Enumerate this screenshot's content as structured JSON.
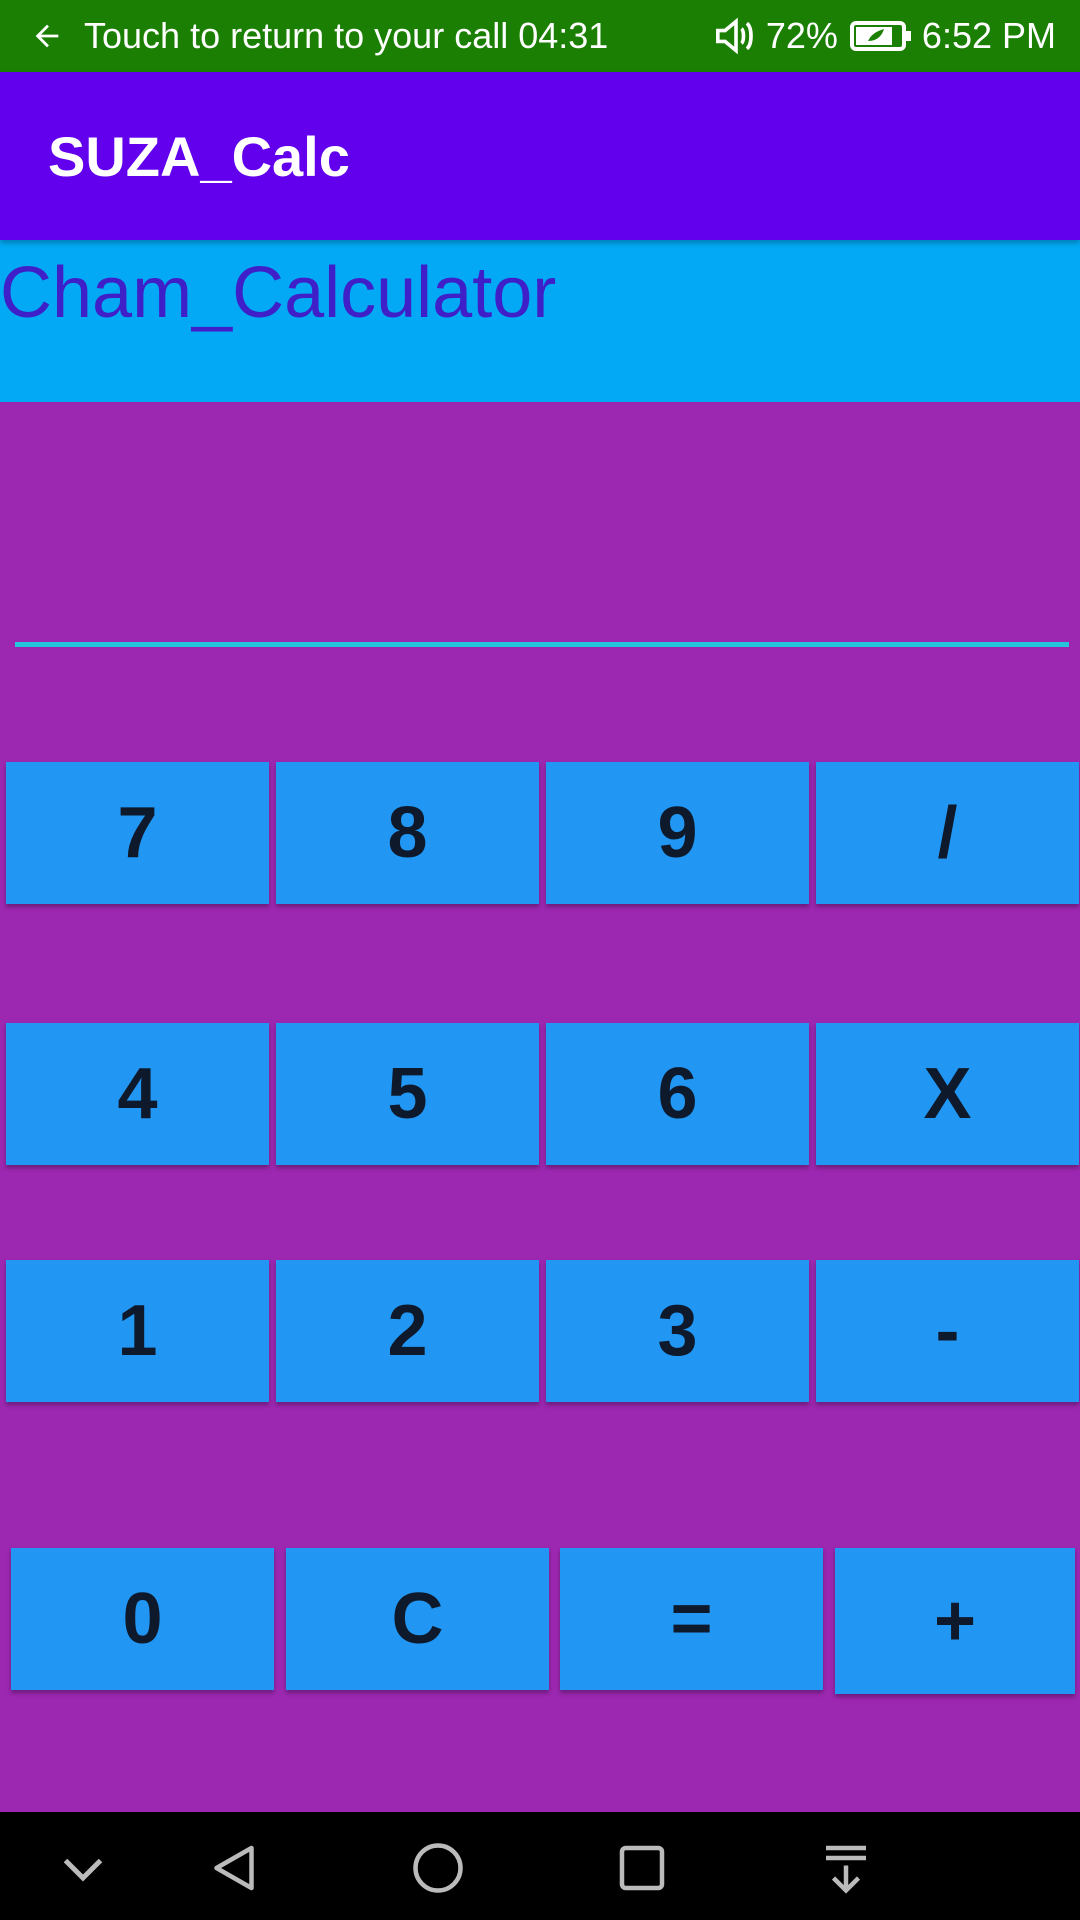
{
  "status_bar": {
    "call_text": "Touch to return to your call",
    "call_timer": "04:31",
    "battery_percent": "72%",
    "time": "6:52 PM"
  },
  "app_bar": {
    "title": "SUZA_Calc"
  },
  "banner": {
    "text": "Cham_Calculator"
  },
  "display": {
    "value": ""
  },
  "keys": {
    "row1": [
      "7",
      "8",
      "9",
      "/"
    ],
    "row2": [
      "4",
      "5",
      "6",
      "X"
    ],
    "row3": [
      "1",
      "2",
      "3",
      "-"
    ],
    "row4": [
      "0",
      "C",
      "=",
      "+"
    ]
  },
  "colors": {
    "status_bar": "#1B7F04",
    "app_bar": "#6200EE",
    "banner": "#03A9F4",
    "banner_text": "#3F1FC8",
    "background": "#9C27B0",
    "key": "#2196F3",
    "input_underline": "#26C6DA"
  },
  "icons": {
    "status": [
      "back-arrow-icon",
      "speaker-icon",
      "battery-icon"
    ],
    "nav": [
      "chevron-down-icon",
      "back-triangle-icon",
      "home-circle-icon",
      "recents-square-icon",
      "notification-pull-icon"
    ]
  }
}
